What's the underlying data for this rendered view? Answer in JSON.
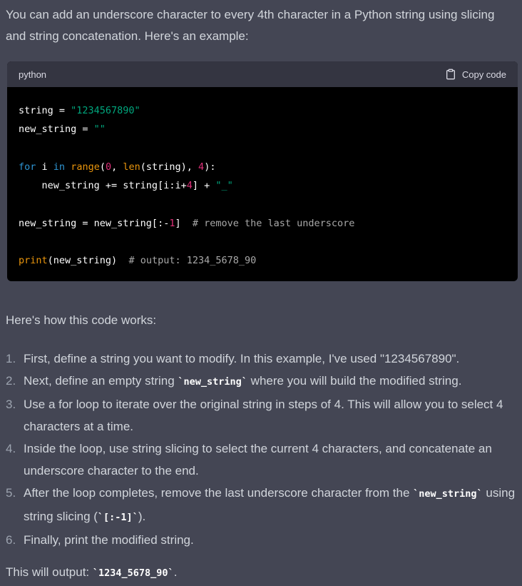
{
  "message": {
    "intro": "You can add an underscore character to every 4th character in a Python string using slicing and string concatenation. Here's an example:",
    "code_block": {
      "language": "python",
      "copy_label": "Copy code",
      "copy_icon": "clipboard-icon",
      "lines": [
        "string = \"1234567890\"",
        "new_string = \"\"",
        "",
        "for i in range(0, len(string), 4):",
        "    new_string += string[i:i+4] + \"_\"",
        "",
        "new_string = new_string[:-1]  # remove the last underscore",
        "",
        "print(new_string)  # output: 1234_5678_90"
      ],
      "colors": {
        "background": "#000000",
        "header": "#343541",
        "keyword": "#2e95d3",
        "string": "#00a67d",
        "number": "#df3079",
        "builtin_call": "#e9950c",
        "comment": "#a8a8a8"
      }
    },
    "explain_heading": "Here's how this code works:",
    "steps": [
      {
        "n": "1.",
        "text": "First, define a string you want to modify. In this example, I've used \"1234567890\"."
      },
      {
        "n": "2.",
        "pre": "Next, define an empty string ",
        "code": "`new_string`",
        "post": " where you will build the modified string."
      },
      {
        "n": "3.",
        "text": "Use a for loop to iterate over the original string in steps of 4. This will allow you to select 4 characters at a time."
      },
      {
        "n": "4.",
        "text": "Inside the loop, use string slicing to select the current 4 characters, and concatenate an underscore character to the end."
      },
      {
        "n": "5.",
        "pre": "After the loop completes, remove the last underscore character from the ",
        "code": "`new_string`",
        "mid": " using string slicing (",
        "code2": "`[:-1]`",
        "post": ")."
      },
      {
        "n": "6.",
        "text": "Finally, print the modified string."
      }
    ],
    "outro": {
      "pre": "This will output: ",
      "code": "`1234_5678_90`",
      "post": "."
    }
  },
  "theme": {
    "page_bg": "#444654",
    "text": "#d1d5db"
  }
}
